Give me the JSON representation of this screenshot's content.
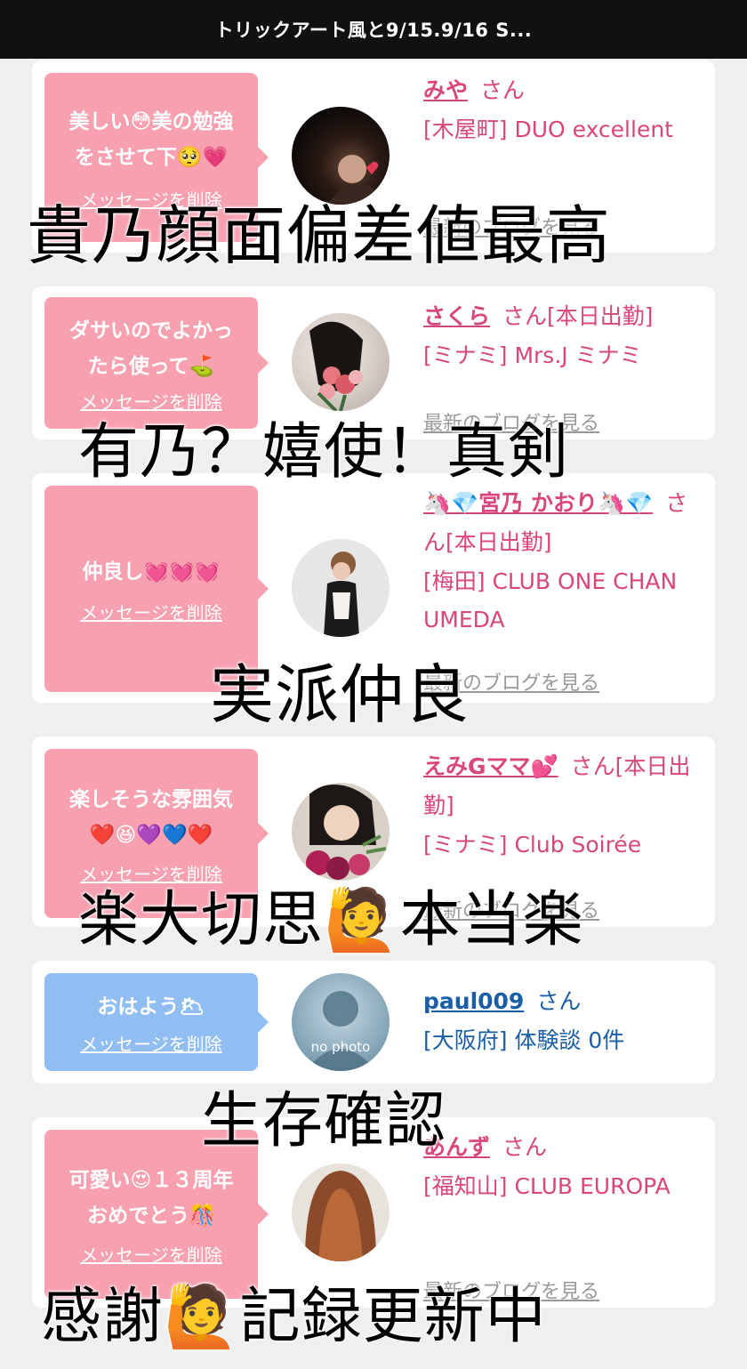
{
  "header": {
    "title": "トリックアート風と9/15.9/16 S..."
  },
  "cards": [
    {
      "message": "美しい😳美の勉強\nをさせて下🥺💗",
      "delete_label": "メッセージを削除",
      "name": "みや",
      "san": "さん",
      "shop": "[木屋町] DUO excellent",
      "blog": "最新のブログを見る"
    },
    {
      "message": "ダサいのでよかっ\nたら使って⛳",
      "delete_label": "メッセージを削除",
      "name": "さくら",
      "san": "さん[本日出勤]",
      "shop": "[ミナミ] Mrs.J ミナミ",
      "blog": "最新のブログを見る"
    },
    {
      "message": "仲良し💓💓💓",
      "delete_label": "メッセージを削除",
      "name": "🦄💎宮乃 かおり🦄💎",
      "san": "さん[本日出勤]",
      "shop": "[梅田] CLUB ONE CHAN UMEDA",
      "blog": "最新のブログを見る"
    },
    {
      "message": "楽しそうな雰囲気\n❤️😆💜💙❤️",
      "delete_label": "メッセージを削除",
      "name": "えみGママ💕",
      "san": "さん[本日出勤]",
      "shop": "[ミナミ] Club Soirée",
      "blog": "最新のブログを見る"
    },
    {
      "message": "おはよう🌥",
      "delete_label": "メッセージを削除",
      "name": "paul009",
      "san": "さん",
      "shop": "[大阪府] 体験談 0件",
      "avatar_text": "no photo"
    },
    {
      "message": "可愛い😍１３周年\nおめでとう🎊",
      "delete_label": "メッセージを削除",
      "name": "あんず",
      "san": "さん",
      "shop": "[福知山] CLUB EUROPA",
      "blog": "最新のブログを見る"
    }
  ],
  "overlays": [
    "貴乃顔面偏差値最高",
    "有乃？嬉使！真剣",
    "実派仲良",
    "楽大切思🙋本当楽",
    "生存確認",
    "感謝🙋記録更新中"
  ],
  "colors": {
    "pink": "#f7a0b0",
    "blue": "#90bdf2",
    "name_pink": "#d9467c",
    "name_blue": "#1a5fa6"
  }
}
